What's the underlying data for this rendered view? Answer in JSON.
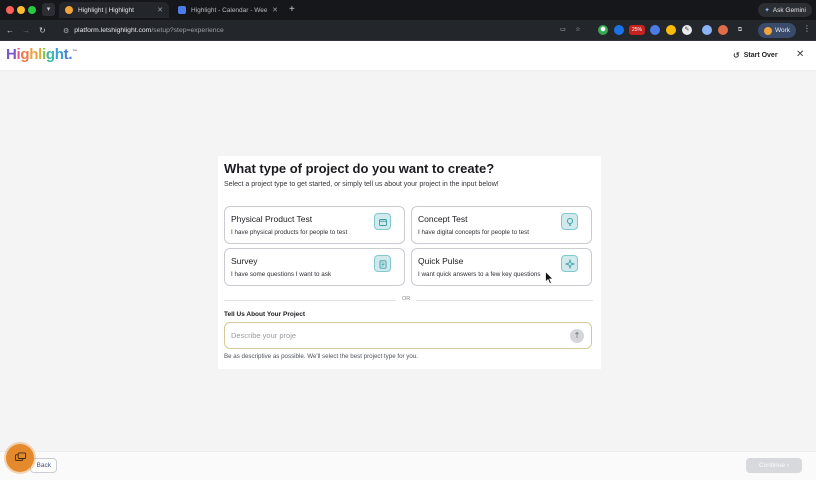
{
  "browser": {
    "tabs": [
      {
        "title": "Highlight | Highlight",
        "favicon_color": "#f0a43a",
        "active": true
      },
      {
        "title": "Highlight - Calendar - Wee",
        "favicon_color": "#4a7de8",
        "active": false
      }
    ],
    "new_tab_label": "+",
    "ask_gemini": "Ask Gemini",
    "url_host": "platform.letshighlight.com",
    "url_path": "/setup?step=experience",
    "profile_label": "Work",
    "extension_badge": "25%"
  },
  "header": {
    "logo_text": "Highlight",
    "start_over": "Start Over"
  },
  "card": {
    "title": "What type of project do you want to create?",
    "subtitle": "Select a project type to get started, or simply tell us about your project in the input below!",
    "options": [
      {
        "title": "Physical Product Test",
        "desc": "I have physical products for people to test",
        "icon": "box-icon"
      },
      {
        "title": "Concept Test",
        "desc": "I have digital concepts for people to test",
        "icon": "lightbulb-icon"
      },
      {
        "title": "Survey",
        "desc": "I have some questions I want to ask",
        "icon": "clipboard-icon"
      },
      {
        "title": "Quick Pulse",
        "desc": "I want quick answers to a few key questions",
        "icon": "sparkle-icon"
      }
    ],
    "or_text": "OR",
    "tell_label": "Tell Us About Your Project",
    "input_placeholder": "Describe your proje",
    "hint": "Be as descriptive as possible. We'll select the best project type for you."
  },
  "footer": {
    "back": "Back",
    "continue": "Continue"
  },
  "colors": {
    "accent_teal": "#83c7cf",
    "chat_orange": "#e58a2c"
  }
}
